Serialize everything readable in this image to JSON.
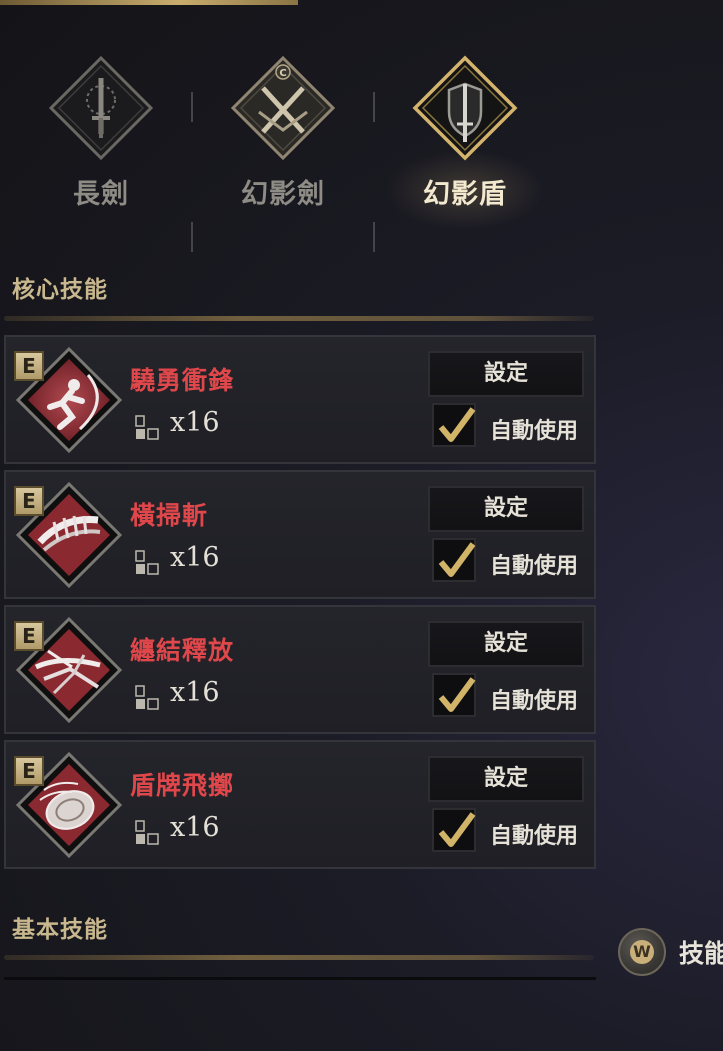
{
  "weapon_tabs": [
    {
      "label": "長劍",
      "icon": "longsword-icon",
      "active": false
    },
    {
      "label": "幻影劍",
      "icon": "phantom-sword-icon",
      "active": false
    },
    {
      "label": "幻影盾",
      "icon": "phantom-shield-icon",
      "active": true
    }
  ],
  "sections": {
    "core_title": "核心技能",
    "basic_title": "基本技能"
  },
  "skills": [
    {
      "key": "E",
      "name": "驍勇衝鋒",
      "cost": "x16",
      "set_label": "設定",
      "auto_label": "自動使用",
      "auto_checked": true,
      "icon": "charge-skill-icon"
    },
    {
      "key": "E",
      "name": "橫掃斬",
      "cost": "x16",
      "set_label": "設定",
      "auto_label": "自動使用",
      "auto_checked": true,
      "icon": "sweep-slash-skill-icon"
    },
    {
      "key": "E",
      "name": "纏結釋放",
      "cost": "x16",
      "set_label": "設定",
      "auto_label": "自動使用",
      "auto_checked": true,
      "icon": "entangle-release-skill-icon"
    },
    {
      "key": "E",
      "name": "盾牌飛擲",
      "cost": "x16",
      "set_label": "設定",
      "auto_label": "自動使用",
      "auto_checked": true,
      "icon": "shield-throw-skill-icon"
    }
  ],
  "skill_shortcut": {
    "key": "W",
    "label": "技能"
  },
  "colors": {
    "accent_gold": "#c9ad6e",
    "skill_name_red": "#e0474a",
    "icon_bg_red": "#8e2a32"
  }
}
